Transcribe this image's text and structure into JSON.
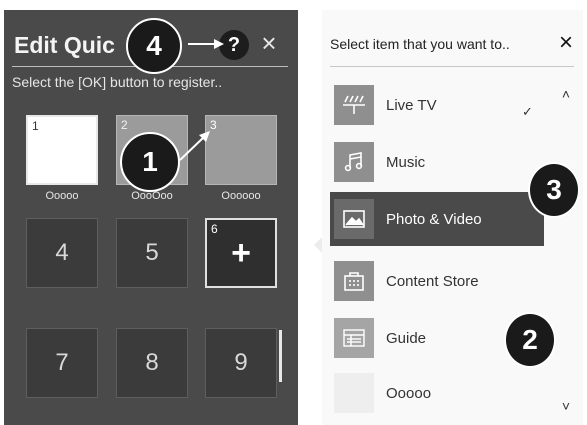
{
  "left_panel": {
    "title": "Edit Quic",
    "help_label": "?",
    "close_label": "×",
    "hint": "Select the [OK] button to register..",
    "slots": [
      {
        "num": "1",
        "big": "",
        "label": "Ooooo"
      },
      {
        "num": "2",
        "big": "",
        "label": "OooOoo"
      },
      {
        "num": "3",
        "big": "",
        "label": "Oooooo"
      },
      {
        "num": "",
        "big": "4",
        "label": ""
      },
      {
        "num": "",
        "big": "5",
        "label": ""
      },
      {
        "num": "6",
        "big": "+",
        "label": ""
      },
      {
        "num": "",
        "big": "7",
        "label": ""
      },
      {
        "num": "",
        "big": "8",
        "label": ""
      },
      {
        "num": "",
        "big": "9",
        "label": ""
      }
    ]
  },
  "right_panel": {
    "title": "Select item that you want to..",
    "close_label": "×",
    "scroll_up": "˄",
    "scroll_down": "˅",
    "check_mark": "✓",
    "items": [
      {
        "label": "Live TV",
        "icon": "live-tv-icon"
      },
      {
        "label": "Music",
        "icon": "music-icon"
      },
      {
        "label": "Photo & Video",
        "icon": "photo-icon"
      },
      {
        "label": "Content Store",
        "icon": "content-store-icon"
      },
      {
        "label": "Guide",
        "icon": "guide-icon"
      },
      {
        "label": "Ooooo",
        "icon": ""
      }
    ]
  },
  "callouts": [
    "1",
    "2",
    "3",
    "4"
  ]
}
